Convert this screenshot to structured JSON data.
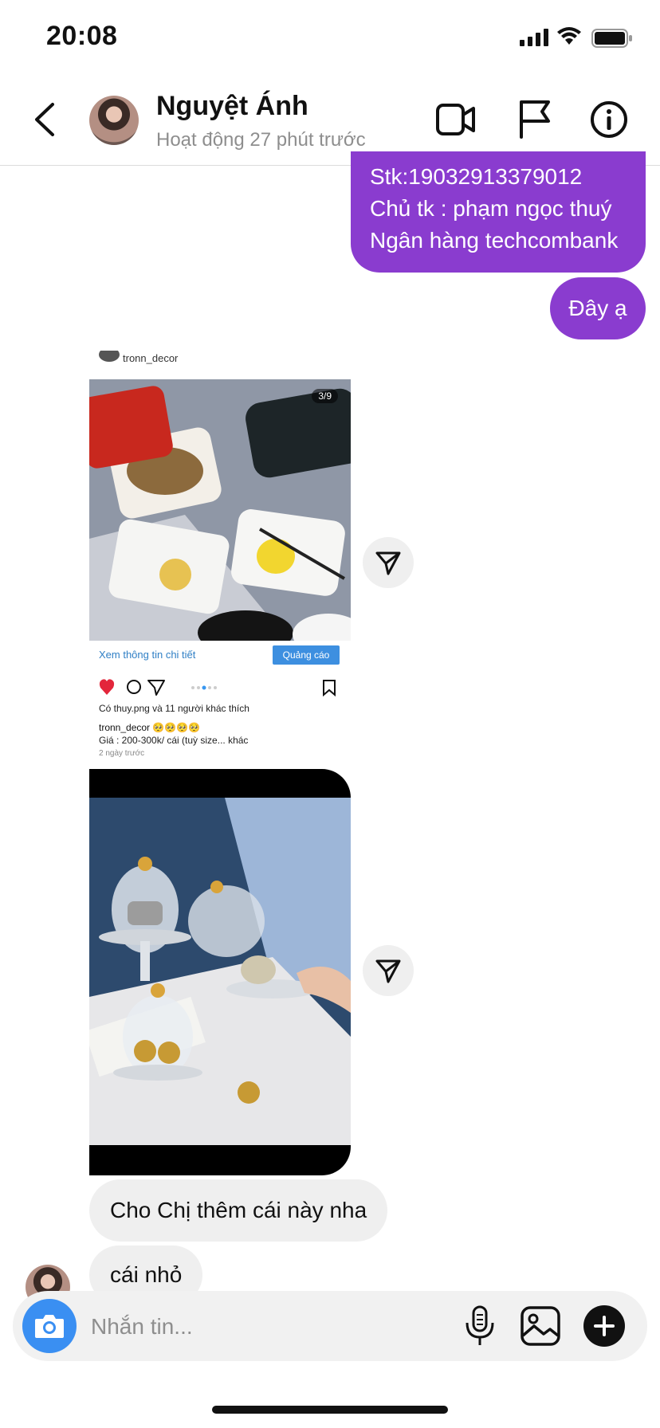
{
  "status_bar": {
    "time": "20:08"
  },
  "header": {
    "contact_name": "Nguyệt Ánh",
    "contact_status": "Hoạt động 27 phút trước"
  },
  "messages": {
    "bank_lines": [
      "Stk:19032913379012",
      "Chủ tk : phạm ngọc thuý",
      "Ngân hàng techcombank"
    ],
    "here": "Đây ạ",
    "add_this": "Cho Chị thêm cái này nha",
    "small_one": "cái nhỏ"
  },
  "shared_post": {
    "username": "tronn_decor",
    "counter": "3/9",
    "details_link": "Xem thông tin chi tiết",
    "ad_badge": "Quảng cáo",
    "likes_text": "Có thuy.png và 11 người khác thích",
    "caption_user": "tronn_decor 🥺🥺🥺🥺",
    "caption_text": "Giá : 200-300k/ cái (tuỳ size... khác",
    "time": "2 ngày trước"
  },
  "composer": {
    "placeholder": "Nhắn tin..."
  },
  "colors": {
    "outgoing_bubble": "#8a3ccf",
    "incoming_bubble": "#efefef",
    "camera_button": "#3a8ff2"
  }
}
